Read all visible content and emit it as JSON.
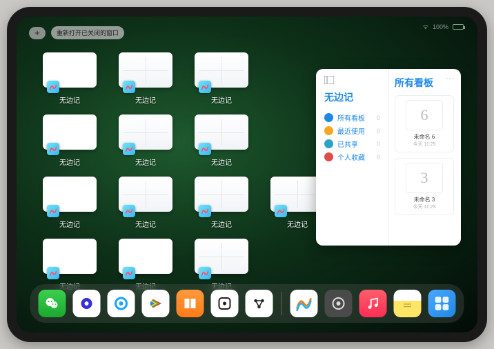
{
  "topbar": {
    "plus_label": "+",
    "reopen_label": "重新打开已关闭的窗口"
  },
  "status": {
    "signal": "•••",
    "battery": "100%"
  },
  "grid": {
    "app_label": "无边记",
    "tiles": [
      {
        "variant": "blank"
      },
      {
        "variant": "grid4"
      },
      {
        "variant": "grid4"
      },
      null,
      {
        "variant": "blank"
      },
      {
        "variant": "grid4"
      },
      {
        "variant": "grid4"
      },
      null,
      {
        "variant": "blank"
      },
      {
        "variant": "grid4"
      },
      {
        "variant": "grid4"
      },
      {
        "variant": "grid4"
      },
      {
        "variant": "blank"
      },
      {
        "variant": "blank"
      },
      {
        "variant": "grid4"
      },
      null
    ]
  },
  "bigwin": {
    "menu": "···",
    "left_title": "无边记",
    "sidebar": [
      {
        "color": "blue",
        "label": "所有看板",
        "count": 0
      },
      {
        "color": "orange",
        "label": "最近使用",
        "count": 0
      },
      {
        "color": "teal",
        "label": "已共享",
        "count": 0
      },
      {
        "color": "red",
        "label": "个人收藏",
        "count": 0
      }
    ],
    "right_title": "所有看板",
    "cards": [
      {
        "glyph": "6",
        "caption": "未命名 6",
        "time": "今天 11:25"
      },
      {
        "glyph": "3",
        "caption": "未命名 3",
        "time": "今天 11:25"
      }
    ]
  },
  "dock": {
    "apps": [
      {
        "id": "wechat"
      },
      {
        "id": "quark"
      },
      {
        "id": "quark2"
      },
      {
        "id": "video"
      },
      {
        "id": "books"
      },
      {
        "id": "dot"
      },
      {
        "id": "sci"
      }
    ],
    "suggested": [
      {
        "id": "freeform"
      },
      {
        "id": "settings"
      },
      {
        "id": "music"
      },
      {
        "id": "notes"
      },
      {
        "id": "library"
      }
    ]
  }
}
